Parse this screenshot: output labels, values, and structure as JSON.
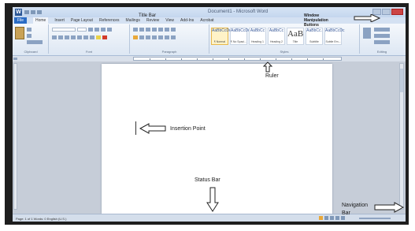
{
  "window": {
    "app_icon": "W",
    "title": "Document1 - Microsoft Word"
  },
  "tabs": [
    "File",
    "Home",
    "Insert",
    "Page Layout",
    "References",
    "Mailings",
    "Review",
    "View",
    "Add-Ins",
    "Acrobat"
  ],
  "ribbon": {
    "groups": [
      "Clipboard",
      "Font",
      "Paragraph",
      "Styles",
      "Editing"
    ],
    "paste_label": "Paste",
    "styles": [
      {
        "sample": "AaBbCcDc",
        "name": "¶ Normal"
      },
      {
        "sample": "AaBbCcDc",
        "name": "¶ No Spaci..."
      },
      {
        "sample": "AaBbCc",
        "name": "Heading 1"
      },
      {
        "sample": "AaBbCc",
        "name": "Heading 2"
      },
      {
        "sample": "AaB",
        "name": "Title"
      },
      {
        "sample": "AaBbCc.",
        "name": "Subtitle"
      },
      {
        "sample": "AaBbCcDc",
        "name": "Subtle Em..."
      }
    ]
  },
  "status": {
    "text": "Page: 1 of 1   Words: 0   English (U.S.)"
  },
  "annotations": {
    "title_bar": "Title Bar",
    "window_nav": "Window Manipulation Buttons",
    "ruler": "Ruler",
    "insertion_point": "Insertion Point",
    "status_bar": "Status Bar",
    "navigation_bar_line1": "Navigation",
    "navigation_bar_line2": "Bar"
  }
}
